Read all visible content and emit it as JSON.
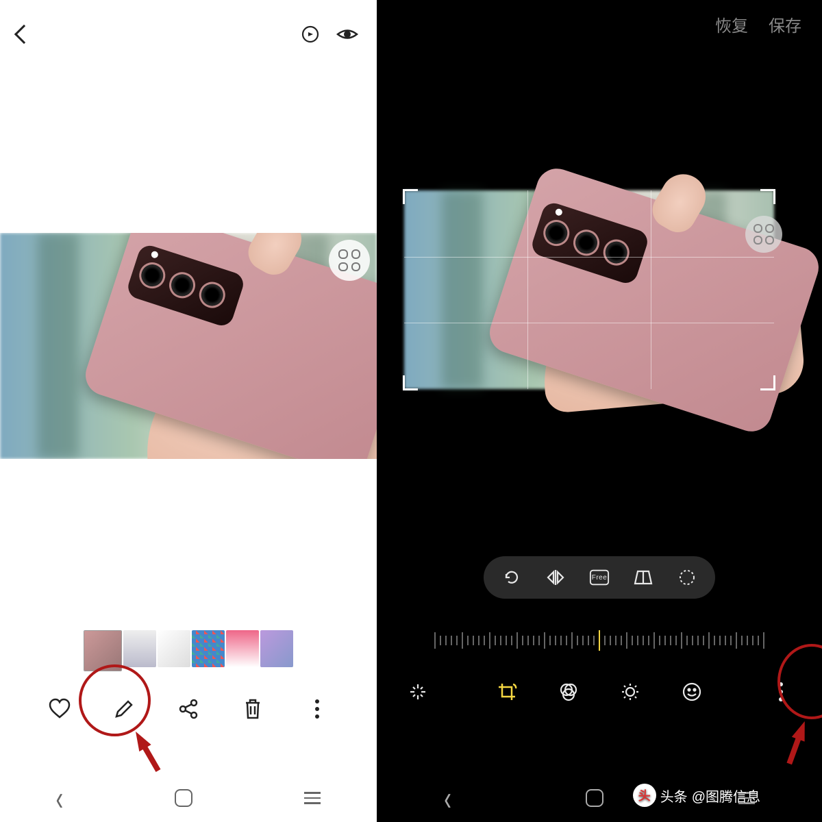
{
  "left": {
    "icons": {
      "back": "back-chevron",
      "bixby_vision": "bixby-vision-icon",
      "view": "eye-icon",
      "overlay": "grid-apps-icon"
    },
    "bottom_bar": {
      "favorite": "heart-icon",
      "edit": "pencil-icon",
      "share": "share-icon",
      "delete": "trash-icon",
      "more": "more-vertical-icon"
    },
    "thumbnail_count": 6
  },
  "right": {
    "top_actions": {
      "restore": "恢复",
      "save": "保存"
    },
    "transform_tools": {
      "rotate": "rotate-ccw-icon",
      "flip_h": "flip-horizontal-icon",
      "ratio": "Free",
      "perspective": "perspective-icon",
      "lasso": "lasso-icon"
    },
    "editor_tools": {
      "auto": "magic-wand-icon",
      "crop": "crop-rotate-icon",
      "filter": "filters-icon",
      "adjust": "brightness-icon",
      "sticker": "smiley-icon",
      "more": "more-vertical-icon"
    },
    "crop_active_color": "#f5d742"
  },
  "watermark": {
    "logo_text": "头",
    "prefix": "头条",
    "handle": "@图腾信息"
  },
  "annotation": {
    "color": "#b01818",
    "targets": [
      "edit-button",
      "editor-more-button"
    ]
  }
}
